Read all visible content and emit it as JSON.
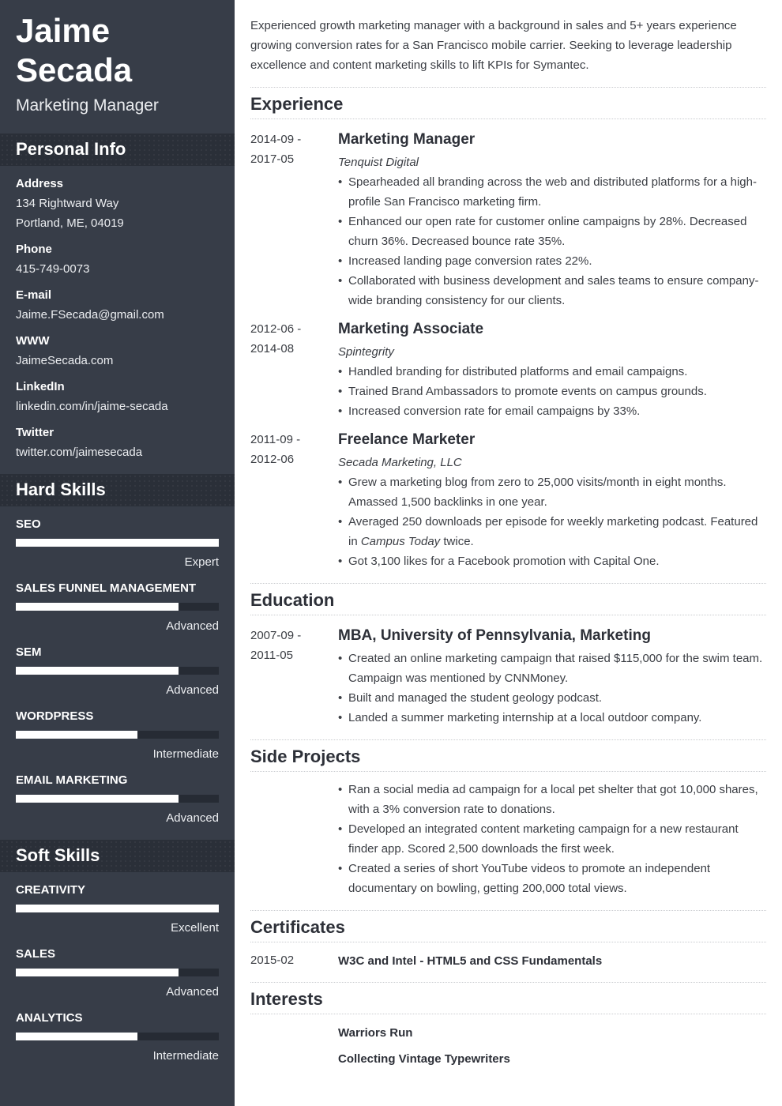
{
  "header": {
    "first_name": "Jaime",
    "last_name": "Secada",
    "title": "Marketing Manager"
  },
  "sidebar": {
    "personal_info": {
      "heading": "Personal Info",
      "fields": [
        {
          "label": "Address",
          "lines": [
            "134 Rightward Way",
            "Portland, ME, 04019"
          ]
        },
        {
          "label": "Phone",
          "lines": [
            "415-749-0073"
          ]
        },
        {
          "label": "E-mail",
          "lines": [
            "Jaime.FSecada@gmail.com"
          ]
        },
        {
          "label": "WWW",
          "lines": [
            "JaimeSecada.com"
          ]
        },
        {
          "label": "LinkedIn",
          "lines": [
            "linkedin.com/in/jaime-secada"
          ]
        },
        {
          "label": "Twitter",
          "lines": [
            "twitter.com/jaimesecada"
          ]
        }
      ]
    },
    "hard_skills": {
      "heading": "Hard Skills",
      "items": [
        {
          "name": "SEO",
          "level": "Expert",
          "fraction": 1.0
        },
        {
          "name": "SALES FUNNEL MANAGEMENT",
          "level": "Advanced",
          "fraction": 0.8
        },
        {
          "name": "SEM",
          "level": "Advanced",
          "fraction": 0.8
        },
        {
          "name": "WORDPRESS",
          "level": "Intermediate",
          "fraction": 0.6
        },
        {
          "name": "EMAIL MARKETING",
          "level": "Advanced",
          "fraction": 0.8
        }
      ]
    },
    "soft_skills": {
      "heading": "Soft Skills",
      "items": [
        {
          "name": "CREATIVITY",
          "level": "Excellent",
          "fraction": 1.0
        },
        {
          "name": "SALES",
          "level": "Advanced",
          "fraction": 0.8
        },
        {
          "name": "ANALYTICS",
          "level": "Intermediate",
          "fraction": 0.6
        }
      ]
    }
  },
  "summary": "Experienced growth marketing manager with a background in sales and 5+ years experience growing conversion rates for a San Francisco mobile carrier. Seeking to leverage leadership excellence and content marketing skills to lift KPIs for Symantec.",
  "experience": {
    "heading": "Experience",
    "items": [
      {
        "date_start": "2014-09 -",
        "date_end": "2017-05",
        "title": "Marketing Manager",
        "company": "Tenquist Digital",
        "bullets": [
          "Spearheaded all branding across the web and distributed platforms for a high-profile San Francisco marketing firm.",
          "Enhanced our open rate for customer online campaigns by 28%. Decreased churn 36%. Decreased bounce rate 35%.",
          "Increased landing page conversion rates 22%.",
          "Collaborated with business development and sales teams to ensure company-wide branding consistency for our clients."
        ]
      },
      {
        "date_start": "2012-06 -",
        "date_end": "2014-08",
        "title": "Marketing Associate",
        "company": "Spintegrity",
        "bullets": [
          "Handled branding for distributed platforms and email campaigns.",
          "Trained Brand Ambassadors to promote events on campus grounds.",
          "Increased conversion rate for email campaigns by 33%."
        ]
      },
      {
        "date_start": "2011-09 -",
        "date_end": "2012-06",
        "title": "Freelance Marketer",
        "company": "Secada Marketing, LLC",
        "bullets": [
          "Grew a marketing blog from zero to 25,000 visits/month in eight months. Amassed 1,500 backlinks in one year.",
          "Averaged 250 downloads per episode for weekly marketing podcast. Featured in Campus Today twice.",
          "Got 3,100 likes for a Facebook promotion with Capital One."
        ]
      }
    ]
  },
  "education": {
    "heading": "Education",
    "items": [
      {
        "date_start": "2007-09 -",
        "date_end": "2011-05",
        "title": "MBA, University of Pennsylvania, Marketing",
        "bullets": [
          "Created an online marketing campaign that raised $115,000 for the swim team. Campaign was mentioned by CNNMoney.",
          "Built and managed the student geology podcast.",
          "Landed a summer marketing internship at a local outdoor company."
        ]
      }
    ]
  },
  "side_projects": {
    "heading": "Side Projects",
    "bullets": [
      "Ran a social media ad campaign for a local pet shelter that got 10,000 shares, with a 3% conversion rate to donations.",
      "Developed an integrated content marketing campaign for a new restaurant finder app. Scored 2,500 downloads the first week.",
      "Created a series of short YouTube videos to promote an independent documentary on bowling, getting 200,000 total views."
    ]
  },
  "certificates": {
    "heading": "Certificates",
    "items": [
      {
        "date": "2015-02",
        "name": "W3C and Intel - HTML5 and CSS Fundamentals"
      }
    ]
  },
  "interests": {
    "heading": "Interests",
    "items": [
      "Warriors Run",
      "Collecting Vintage Typewriters"
    ]
  }
}
